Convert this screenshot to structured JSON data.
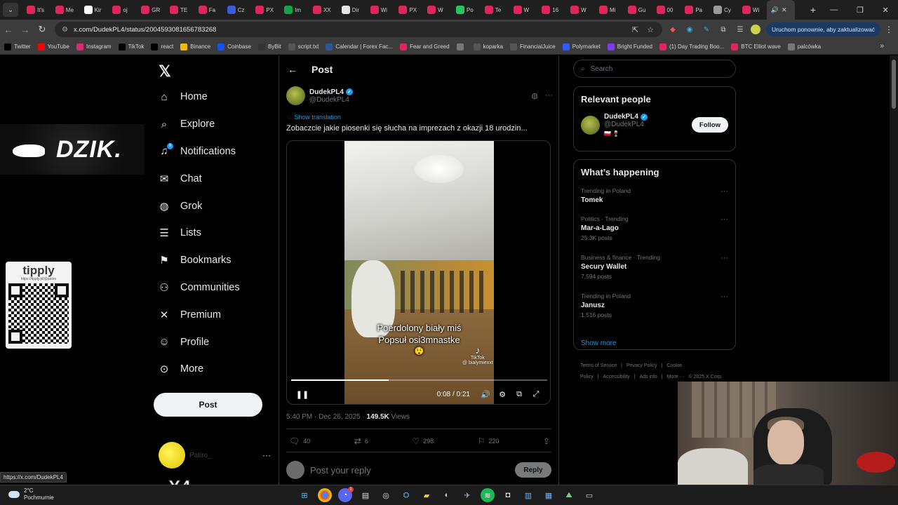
{
  "browser": {
    "tabs": [
      {
        "label": "It's",
        "color": "#e0245e"
      },
      {
        "label": "Me",
        "color": "#e0245e"
      },
      {
        "label": "Kir",
        "color": "#ffffff"
      },
      {
        "label": "oj",
        "color": "#e0245e"
      },
      {
        "label": "GR",
        "color": "#e0245e"
      },
      {
        "label": "TE",
        "color": "#e0245e"
      },
      {
        "label": "Fa",
        "color": "#e0245e"
      },
      {
        "label": "Cz",
        "color": "#3b5bdb"
      },
      {
        "label": "PX",
        "color": "#e0245e"
      },
      {
        "label": "Im",
        "color": "#16a34a"
      },
      {
        "label": "XX",
        "color": "#e0245e"
      },
      {
        "label": "Dir",
        "color": "#e5e5e5"
      },
      {
        "label": "Wi",
        "color": "#e0245e"
      },
      {
        "label": "PX",
        "color": "#e0245e"
      },
      {
        "label": "W",
        "color": "#e0245e"
      },
      {
        "label": "Po",
        "color": "#22c55e"
      },
      {
        "label": "Te",
        "color": "#e0245e"
      },
      {
        "label": "W",
        "color": "#e0245e"
      },
      {
        "label": "16",
        "color": "#e0245e"
      },
      {
        "label": "W",
        "color": "#e0245e"
      },
      {
        "label": "Mi",
        "color": "#e0245e"
      },
      {
        "label": "Gu",
        "color": "#e0245e"
      },
      {
        "label": "00",
        "color": "#e0245e"
      },
      {
        "label": "Pa",
        "color": "#e0245e"
      },
      {
        "label": "Cy",
        "color": "#9a9a9a"
      },
      {
        "label": "Wi",
        "color": "#e0245e"
      }
    ],
    "active_tab_icon": "speaker-icon",
    "url": "x.com/DudekPL4/status/2004593081656783268",
    "update_button": "Uruchom ponownie, aby zaktualizować",
    "bookmarks": [
      {
        "label": "Twitter",
        "color": "#000000"
      },
      {
        "label": "YouTube",
        "color": "#ff0000"
      },
      {
        "label": "Instagram",
        "color": "#d62976"
      },
      {
        "label": "TikTok",
        "color": "#000000"
      },
      {
        "label": "react",
        "color": "#000000"
      },
      {
        "label": "Binance",
        "color": "#f0b90b"
      },
      {
        "label": "Coinbase",
        "color": "#1652f0"
      },
      {
        "label": "ByBit",
        "color": "#333333"
      },
      {
        "label": "script.txt",
        "color": "#555555"
      },
      {
        "label": "Calendar | Forex Fac...",
        "color": "#2b5797"
      },
      {
        "label": "Fear and Greed",
        "color": "#e0245e"
      },
      {
        "label": "",
        "color": "#777777"
      },
      {
        "label": "koparka",
        "color": "#555555"
      },
      {
        "label": "FinancialJuice",
        "color": "#555555"
      },
      {
        "label": "Polymarket",
        "color": "#2e5cff"
      },
      {
        "label": "Bright Funded",
        "color": "#7c3aed"
      },
      {
        "label": "(1) Day Trading Boo...",
        "color": "#e0245e"
      },
      {
        "label": "BTC Elliot wave",
        "color": "#e0245e"
      },
      {
        "label": "palcówka",
        "color": "#777777"
      }
    ]
  },
  "overlays": {
    "dzik": "DZIK.",
    "tipply_brand": "tipply",
    "tipply_link": "https://tipply.pl/@patiro",
    "x4": "X4",
    "status_url": "https://x.com/DudekPL4"
  },
  "nav": {
    "items": [
      {
        "label": "Home",
        "icon": "⌂"
      },
      {
        "label": "Explore",
        "icon": "⌕"
      },
      {
        "label": "Notifications",
        "icon": "♫"
      },
      {
        "label": "Chat",
        "icon": "✉"
      },
      {
        "label": "Grok",
        "icon": "◍"
      },
      {
        "label": "Lists",
        "icon": "☰"
      },
      {
        "label": "Bookmarks",
        "icon": "⚑"
      },
      {
        "label": "Communities",
        "icon": "⚇"
      },
      {
        "label": "Premium",
        "icon": "✕"
      },
      {
        "label": "Profile",
        "icon": "☺"
      },
      {
        "label": "More",
        "icon": "⊙"
      }
    ],
    "notifications_badge": "9",
    "post_button": "Post",
    "account_handle": "Patiro_"
  },
  "main": {
    "title": "Post",
    "author_name": "DudekPL4",
    "author_handle": "@DudekPL4",
    "show_translation": "Show translation",
    "text": "Zobaczcie jakie piosenki się słucha na imprezach z okazji 18 urodzin...",
    "video": {
      "caption_line1": "Poerdolony biały miś",
      "caption_line2": "Popsuł osi3mnastke",
      "caption_emoji": "😲",
      "watermark": "TikTok",
      "watermark_handle": "@ bialymiexxt",
      "time": "0:08 / 0:21",
      "progress_fraction": 0.38
    },
    "timestamp": "5:40 PM · Dec 26, 2025 · ",
    "views_count": "149.5K",
    "views_label": " Views",
    "actions": {
      "replies": "40",
      "reposts": "6",
      "likes": "298",
      "bookmarks": "220"
    },
    "reply_placeholder": "Post your reply",
    "reply_button": "Reply"
  },
  "right": {
    "search_placeholder": "Search",
    "relevant_title": "Relevant people",
    "person_name": "DudekPL4",
    "person_handle": "@DudekPL4",
    "person_flags": "🇵🇱 🍷",
    "follow_button": "Follow",
    "happening_title": "What’s happening",
    "trends": [
      {
        "context": "Trending in Poland",
        "title": "Tomek",
        "count": ""
      },
      {
        "context": "Politics · Trending",
        "title": "Mar-a-Lago",
        "count": "25.3K posts"
      },
      {
        "context": "Business & finance · Trending",
        "title": "Secury Wallet",
        "count": "7,594 posts"
      },
      {
        "context": "Trending in Poland",
        "title": "Janusz",
        "count": "1,516 posts"
      }
    ],
    "show_more": "Show more",
    "footer": [
      "Terms of Service",
      "|",
      "Privacy Policy",
      "|",
      "Cookie Policy",
      "|",
      "Accessibility",
      "|",
      "Ads info",
      "|",
      "More ···",
      "© 2025 X Corp."
    ]
  },
  "taskbar": {
    "temp": "2°C",
    "condition": "Pochmurnie"
  }
}
